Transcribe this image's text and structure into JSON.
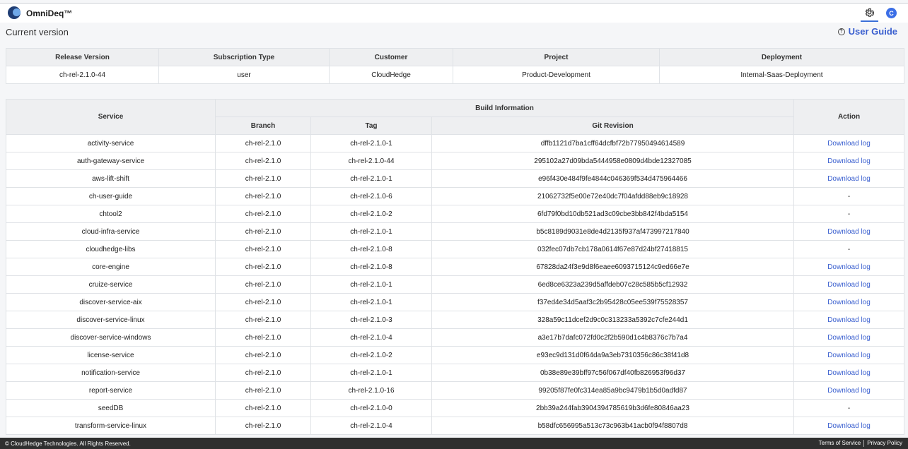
{
  "header": {
    "brand": "OmniDeq™",
    "avatar_initial": "C"
  },
  "page": {
    "title": "Current version",
    "user_guide": "User Guide"
  },
  "release": {
    "columns": [
      "Release Version",
      "Subscription Type",
      "Customer",
      "Project",
      "Deployment"
    ],
    "row": [
      "ch-rel-2.1.0-44",
      "user",
      "CloudHedge",
      "Product-Development",
      "Internal-Saas-Deployment"
    ]
  },
  "build": {
    "service_header": "Service",
    "group_header": "Build Information",
    "action_header": "Action",
    "sub_headers": [
      "Branch",
      "Tag",
      "Git Revision"
    ],
    "rows": [
      {
        "service": "activity-service",
        "branch": "ch-rel-2.1.0",
        "tag": "ch-rel-2.1.0-1",
        "git": "dffb1121d7ba1cff64dcfbf72b77950494614589",
        "action": "Download log"
      },
      {
        "service": "auth-gateway-service",
        "branch": "ch-rel-2.1.0",
        "tag": "ch-rel-2.1.0-44",
        "git": "295102a27d09bda5444958e0809d4bde12327085",
        "action": "Download log"
      },
      {
        "service": "aws-lift-shift",
        "branch": "ch-rel-2.1.0",
        "tag": "ch-rel-2.1.0-1",
        "git": "e96f430e484f9fe4844c046369f534d475964466",
        "action": "Download log"
      },
      {
        "service": "ch-user-guide",
        "branch": "ch-rel-2.1.0",
        "tag": "ch-rel-2.1.0-6",
        "git": "21062732f5e00e72e40dc7f04afdd88eb9c18928",
        "action": "-"
      },
      {
        "service": "chtool2",
        "branch": "ch-rel-2.1.0",
        "tag": "ch-rel-2.1.0-2",
        "git": "6fd79f0bd10db521ad3c09cbe3bb842f4bda5154",
        "action": "-"
      },
      {
        "service": "cloud-infra-service",
        "branch": "ch-rel-2.1.0",
        "tag": "ch-rel-2.1.0-1",
        "git": "b5c8189d9031e8de4d2135f937af473997217840",
        "action": "Download log"
      },
      {
        "service": "cloudhedge-libs",
        "branch": "ch-rel-2.1.0",
        "tag": "ch-rel-2.1.0-8",
        "git": "032fec07db7cb178a0614f67e87d24bf27418815",
        "action": "-"
      },
      {
        "service": "core-engine",
        "branch": "ch-rel-2.1.0",
        "tag": "ch-rel-2.1.0-8",
        "git": "67828da24f3e9d8f6eaee6093715124c9ed66e7e",
        "action": "Download log"
      },
      {
        "service": "cruize-service",
        "branch": "ch-rel-2.1.0",
        "tag": "ch-rel-2.1.0-1",
        "git": "6ed8ce6323a239d5affdeb07c28c585b5cf12932",
        "action": "Download log"
      },
      {
        "service": "discover-service-aix",
        "branch": "ch-rel-2.1.0",
        "tag": "ch-rel-2.1.0-1",
        "git": "f37ed4e34d5aaf3c2b95428c05ee539f75528357",
        "action": "Download log"
      },
      {
        "service": "discover-service-linux",
        "branch": "ch-rel-2.1.0",
        "tag": "ch-rel-2.1.0-3",
        "git": "328a59c11dcef2d9c0c313233a5392c7cfe244d1",
        "action": "Download log"
      },
      {
        "service": "discover-service-windows",
        "branch": "ch-rel-2.1.0",
        "tag": "ch-rel-2.1.0-4",
        "git": "a3e17b7dafc072fd0c2f2b590d1c4b8376c7b7a4",
        "action": "Download log"
      },
      {
        "service": "license-service",
        "branch": "ch-rel-2.1.0",
        "tag": "ch-rel-2.1.0-2",
        "git": "e93ec9d131d0f64da9a3eb7310356c86c38f41d8",
        "action": "Download log"
      },
      {
        "service": "notification-service",
        "branch": "ch-rel-2.1.0",
        "tag": "ch-rel-2.1.0-1",
        "git": "0b38e89e39bff97c56f067df40fb826953f96d37",
        "action": "Download log"
      },
      {
        "service": "report-service",
        "branch": "ch-rel-2.1.0",
        "tag": "ch-rel-2.1.0-16",
        "git": "99205f87fe0fc314ea85a9bc9479b1b5d0adfd87",
        "action": "Download log"
      },
      {
        "service": "seedDB",
        "branch": "ch-rel-2.1.0",
        "tag": "ch-rel-2.1.0-0",
        "git": "2bb39a244fab3904394785619b3d6fe80846aa23",
        "action": "-"
      },
      {
        "service": "transform-service-linux",
        "branch": "ch-rel-2.1.0",
        "tag": "ch-rel-2.1.0-4",
        "git": "b58dfc656995a513c73c963b41acb0f94f8807d8",
        "action": "Download log"
      }
    ]
  },
  "footer": {
    "copyright": "© CloudHedge Technologies. All Rights Reserved.",
    "terms": "Terms of Service",
    "privacy": "Privacy Policy"
  },
  "icons": {
    "settings": "gear-icon",
    "help": "question-circle-icon",
    "logo": "omnideq-logo-icon"
  },
  "colors": {
    "accent": "#3a5fcf",
    "avatar": "#3b6ee6",
    "footer_bg": "#2f2f2f",
    "header_cell_bg": "#eeeff1"
  }
}
